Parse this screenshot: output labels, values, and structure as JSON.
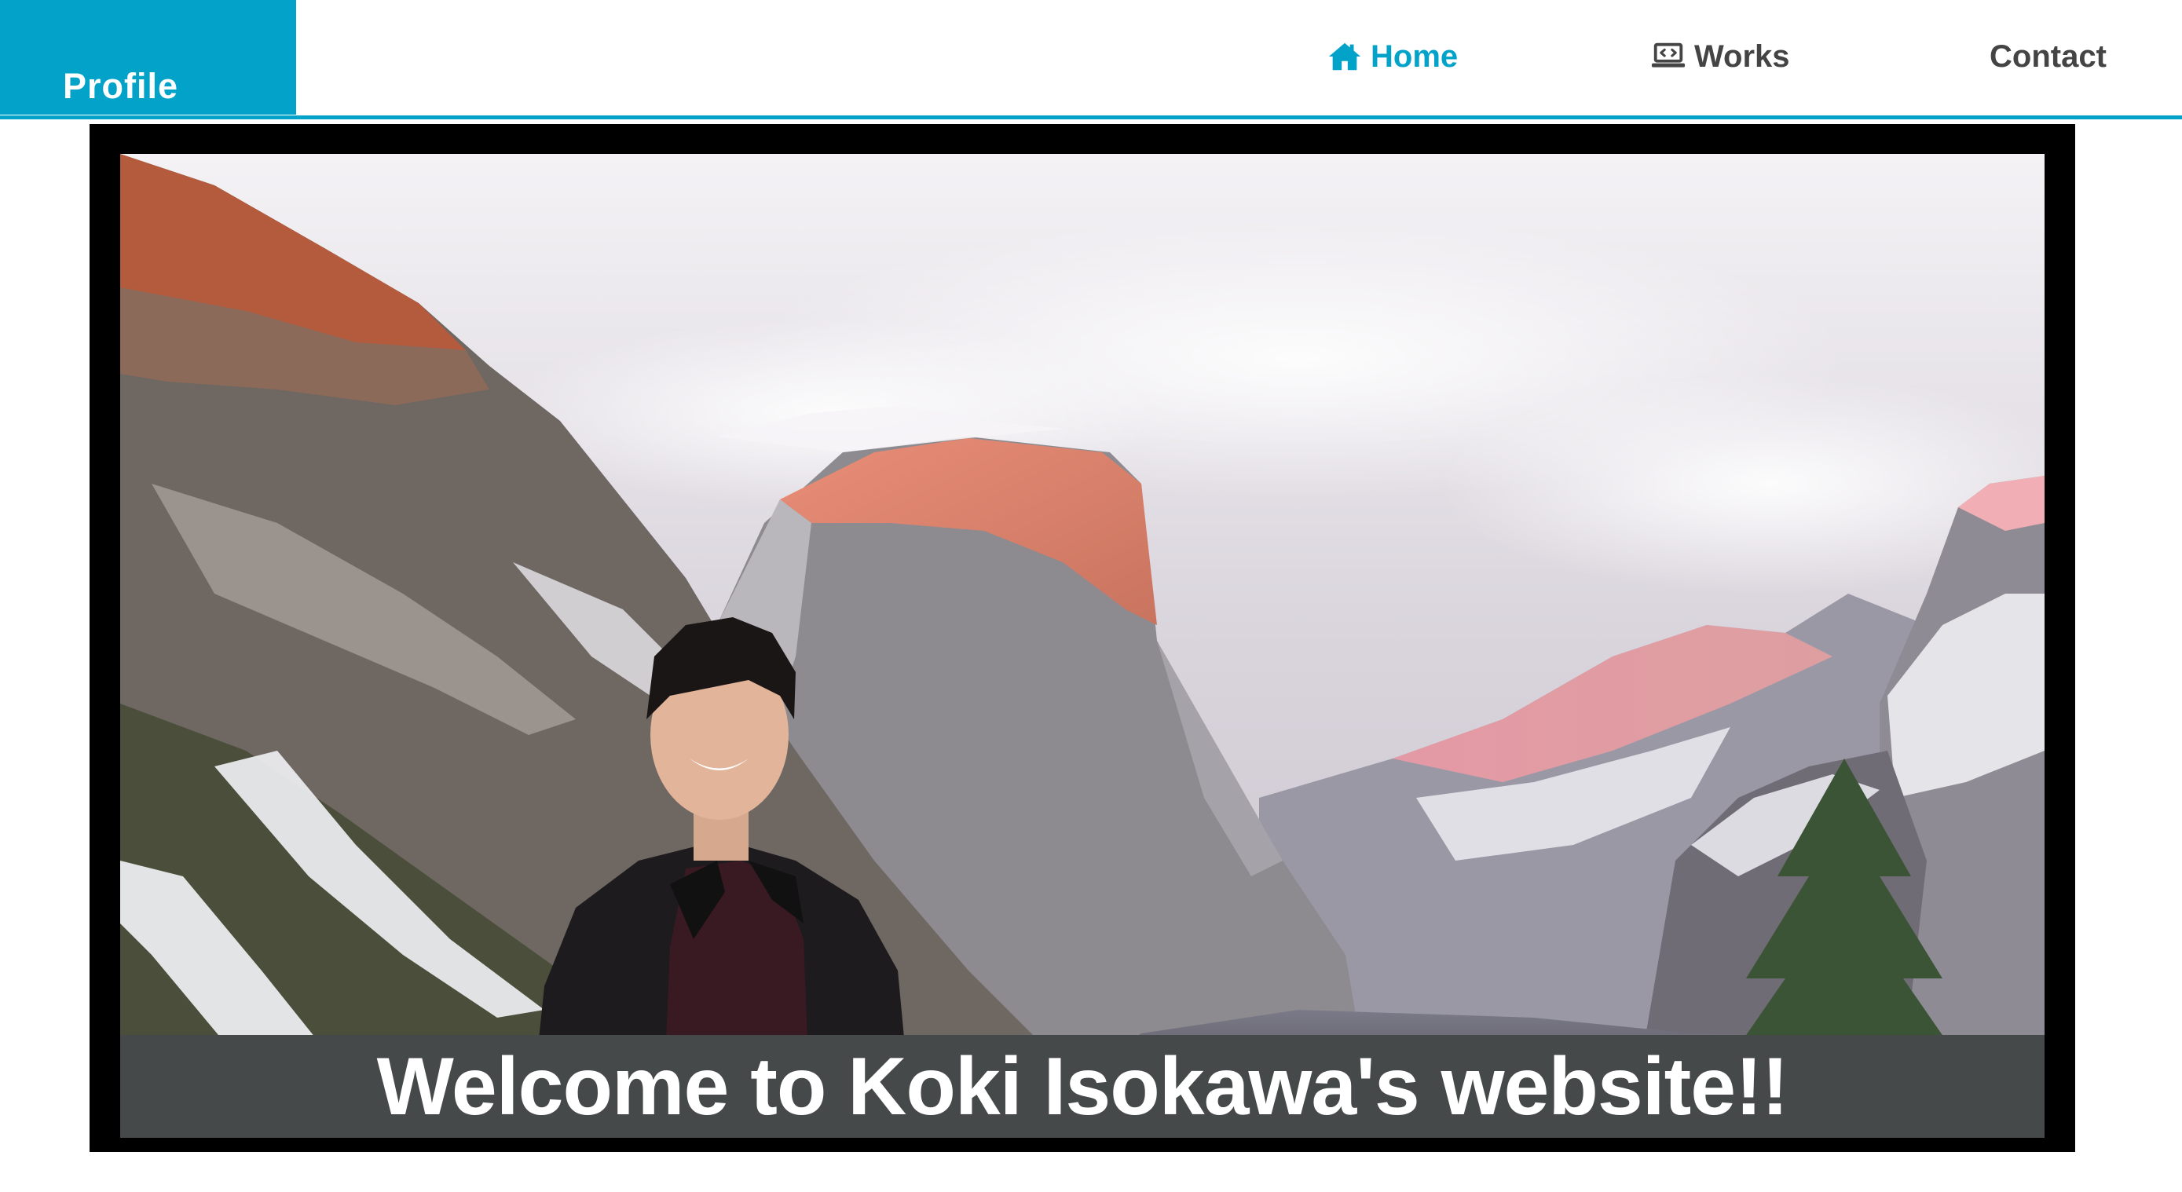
{
  "header": {
    "brand": "Profile",
    "nav": [
      {
        "label": "Home",
        "icon": "home-icon",
        "active": true
      },
      {
        "label": "Works",
        "icon": "laptop-code-icon",
        "active": false
      },
      {
        "label": "Contact",
        "icon": null,
        "active": false
      }
    ]
  },
  "hero": {
    "caption": "Welcome to Koki Isokawa's website!!",
    "photo": "portrait-with-snowy-mountains"
  },
  "colors": {
    "accent": "#03a3c9",
    "nav_text": "#444444",
    "frame": "#000000",
    "caption_bg": "#45494a"
  }
}
